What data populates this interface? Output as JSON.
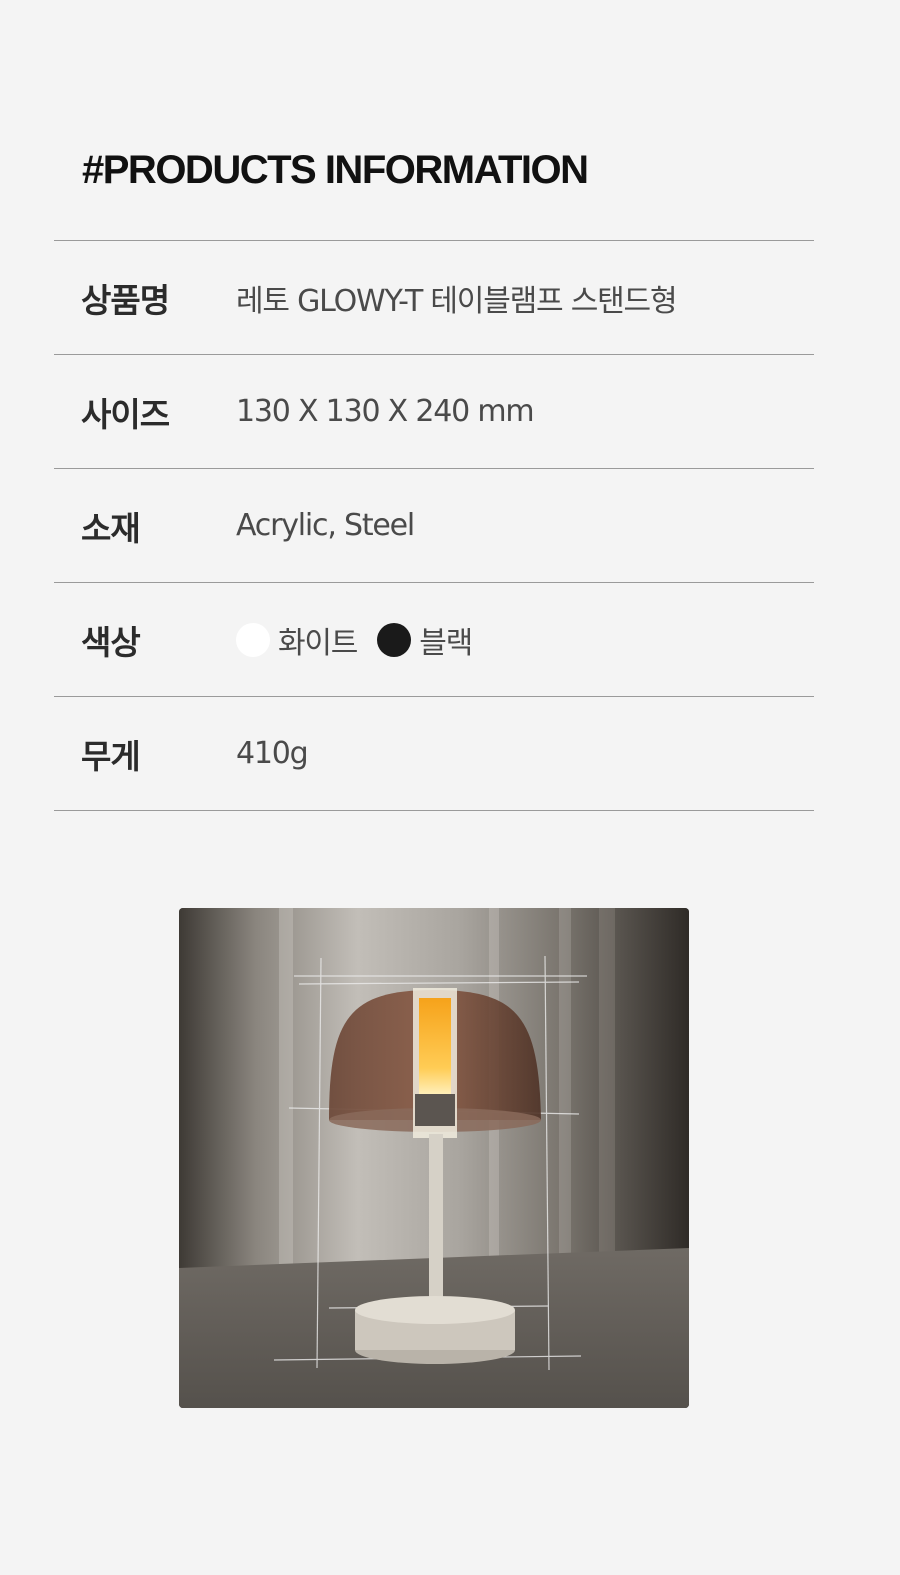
{
  "section_title": "#PRODUCTS INFORMATION",
  "rows": [
    {
      "label": "상품명",
      "value": "레토 GLOWY-T 테이블램프 스탠드형"
    },
    {
      "label": "사이즈",
      "value": "130 X 130 X  240 mm"
    },
    {
      "label": "소재",
      "value": "Acrylic, Steel"
    },
    {
      "label": "색상",
      "colors": [
        {
          "name": "화이트",
          "hex": "#ffffff"
        },
        {
          "name": "블랙",
          "hex": "#1a1a1a"
        }
      ]
    },
    {
      "label": "무게",
      "value": "410g"
    }
  ],
  "image": {
    "subject": "table-lamp-photo"
  }
}
